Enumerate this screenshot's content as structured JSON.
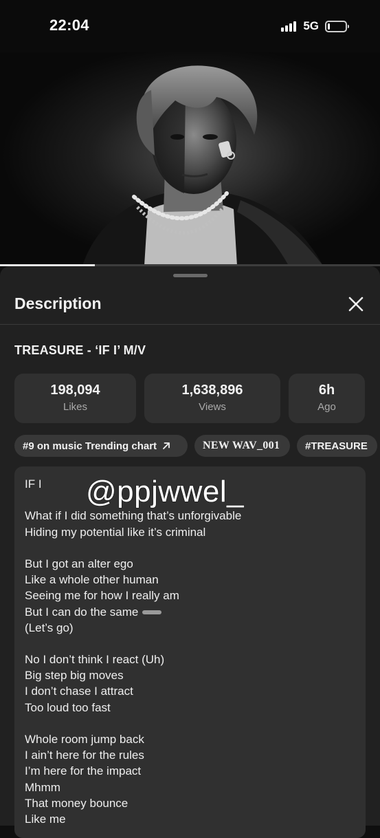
{
  "status_bar": {
    "time": "22:04",
    "network": "5G",
    "battery_level": 0.12
  },
  "video": {
    "progress": 0.25,
    "thumbnail_icon": "portrait-icon"
  },
  "description_panel": {
    "title": "Description",
    "close_icon": "close-icon",
    "video_title": "TREASURE - ‘IF I’ M/V",
    "stats": [
      {
        "value": "198,094",
        "label": "Likes"
      },
      {
        "value": "1,638,896",
        "label": "Views"
      },
      {
        "value": "6h",
        "label": "Ago"
      }
    ],
    "chips": [
      {
        "label": "#9 on music Trending chart",
        "icon": "arrow-up-right-icon"
      },
      {
        "label": "NEW WAV_001"
      },
      {
        "label": "#TREASURE"
      }
    ],
    "watermark": "@ppjwwel_",
    "lyrics": [
      "IF I",
      "",
      "What if I did something that’s unforgivable",
      "Hiding my potential like it’s criminal",
      "",
      "But I got an alter ego",
      "Like a whole other human",
      "Seeing me for how I really am",
      "But I can do the same",
      "(Let’s go)",
      "",
      "No I don’t think I react (Uh)",
      "Big step big moves",
      "I don’t chase I attract",
      "Too loud too fast",
      "",
      "Whole room jump back",
      "I ain’t here for the rules",
      "I’m here for the impact",
      "Mhmm",
      "That money bounce",
      "Like me"
    ]
  },
  "colors": {
    "background": "#0f0f0f",
    "sheet": "#212121",
    "card": "#303030",
    "chip": "#383838",
    "text": "#f1f1f1",
    "muted": "#aaaaaa"
  }
}
